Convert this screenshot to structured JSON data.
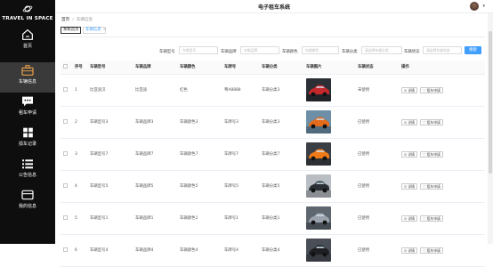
{
  "sidebar": {
    "brand": "TRAVEL IN SPACE",
    "items": [
      {
        "label": "首页",
        "icon": "home-icon",
        "active": false
      },
      {
        "label": "车辆信息",
        "icon": "briefcase-icon",
        "active": true
      },
      {
        "label": "租车申请",
        "icon": "chat-icon",
        "active": false
      },
      {
        "label": "损车记录",
        "icon": "grid-icon",
        "active": false
      },
      {
        "label": "公告信息",
        "icon": "list-icon",
        "active": false
      },
      {
        "label": "我的信息",
        "icon": "wallet-icon",
        "active": false
      }
    ]
  },
  "header": {
    "title": "电子租车系统",
    "user_caret": "▾"
  },
  "breadcrumb": {
    "home": "首页",
    "sep": "/",
    "current": "车辆信息"
  },
  "tabs": [
    {
      "label": "系统首页"
    },
    {
      "label": "车辆信息",
      "close": "×"
    }
  ],
  "filters": [
    {
      "label": "车辆型号",
      "placeholder": "车辆型号"
    },
    {
      "label": "车辆品牌",
      "placeholder": "车辆品牌"
    },
    {
      "label": "车辆颜色",
      "placeholder": "车辆颜色"
    },
    {
      "label": "车辆分类",
      "placeholder": "请选择车辆分类"
    },
    {
      "label": "车辆状态",
      "placeholder": "请选择车辆状态"
    }
  ],
  "search_button": "搜索",
  "table": {
    "headers": [
      "",
      "序号",
      "车辆型号",
      "车辆品牌",
      "车辆颜色",
      "车牌号",
      "车辆分类",
      "车辆图片",
      "车辆状态",
      "操作"
    ],
    "rows": [
      {
        "no": "1",
        "model": "比亚迪汉",
        "brand": "比亚迪",
        "color": "红色",
        "plate": "粤A8888",
        "category": "车辆分类3",
        "image": "car-red",
        "status": "未使用"
      },
      {
        "no": "2",
        "model": "车辆型号3",
        "brand": "车辆品牌3",
        "color": "车辆颜色3",
        "plate": "车牌号3",
        "category": "车辆分类3",
        "image": "car-orange",
        "status": "已使用"
      },
      {
        "no": "3",
        "model": "车辆型号7",
        "brand": "车辆品牌7",
        "color": "车辆颜色7",
        "plate": "车牌号7",
        "category": "车辆分类7",
        "image": "car-orange2",
        "status": "已使用"
      },
      {
        "no": "4",
        "model": "车辆型号5",
        "brand": "车辆品牌5",
        "color": "车辆颜色5",
        "plate": "车牌号5",
        "category": "车辆分类5",
        "image": "car-dark",
        "status": "已使用"
      },
      {
        "no": "5",
        "model": "车辆型号1",
        "brand": "车辆品牌1",
        "color": "车辆颜色1",
        "plate": "车牌号1",
        "category": "车辆分类1",
        "image": "car-gray",
        "status": "已使用"
      },
      {
        "no": "6",
        "model": "车辆型号4",
        "brand": "车辆品牌4",
        "color": "车辆颜色4",
        "plate": "车牌号4",
        "category": "车辆分类4",
        "image": "car-black",
        "status": "已使用"
      }
    ],
    "actions": {
      "detail": "详情",
      "rent": "租车申请"
    }
  },
  "colors": {
    "sidebar_bg": "#0e0e0e",
    "sidebar_active": "#3a3a3a",
    "accent": "#409eff"
  }
}
